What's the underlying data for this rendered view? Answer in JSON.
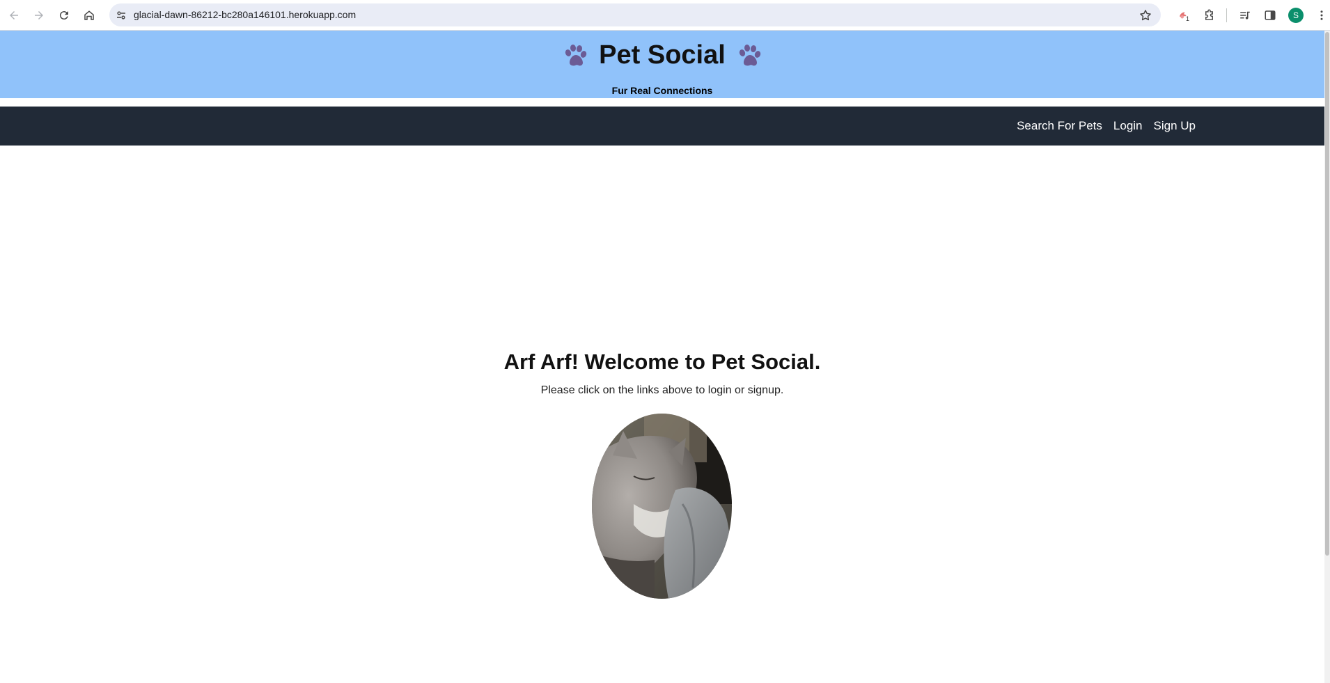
{
  "browser": {
    "url": "glacial-dawn-86212-bc280a146101.herokuapp.com",
    "extension_badge": "1",
    "profile_initial": "S",
    "icons": [
      "back-icon",
      "forward-icon",
      "reload-icon",
      "home-icon",
      "site-settings-icon",
      "bookmark-star-icon",
      "extension-icon",
      "puzzle-icon",
      "media-icon",
      "side-panel-icon",
      "menu-icon"
    ]
  },
  "header": {
    "title": "Pet Social",
    "tagline": "Fur Real Connections",
    "icon": "paw-icon",
    "background_color": "#90c2fa"
  },
  "nav": {
    "background_color": "#212a37",
    "links": [
      {
        "label": "Search For Pets"
      },
      {
        "label": "Login"
      },
      {
        "label": "Sign Up"
      }
    ]
  },
  "main": {
    "heading": "Arf Arf! Welcome to Pet Social.",
    "text": "Please click on the links above to login or signup.",
    "image": "sleeping-cat-photo"
  }
}
